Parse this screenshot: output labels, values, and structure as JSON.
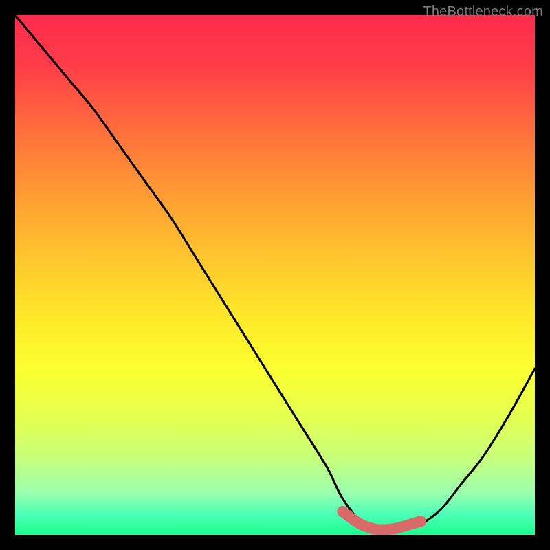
{
  "watermark": "TheBottleneck.com",
  "chart_data": {
    "type": "line",
    "title": "",
    "xlabel": "",
    "ylabel": "",
    "x_range": [
      0,
      100
    ],
    "y_range": [
      0,
      100
    ],
    "grid": false,
    "legend": false,
    "series": [
      {
        "name": "curve",
        "color": "#000000",
        "x": [
          0,
          5,
          10,
          15,
          20,
          25,
          30,
          35,
          40,
          45,
          50,
          55,
          60,
          63,
          67,
          70,
          75,
          78,
          82,
          86,
          90,
          95,
          100
        ],
        "y": [
          100,
          94,
          88,
          82,
          75,
          68,
          61,
          53,
          45,
          37,
          29,
          21,
          13,
          7,
          2,
          1,
          1,
          2,
          5,
          10,
          15,
          23,
          32
        ]
      }
    ],
    "highlight_segment": {
      "color": "#d86a6a",
      "x": [
        63,
        65,
        67,
        70,
        73,
        75,
        78
      ],
      "y": [
        4.5,
        3.0,
        1.8,
        1.0,
        1.2,
        1.7,
        2.6
      ]
    },
    "highlight_point": {
      "color": "#d86a6a",
      "x": 78,
      "y": 2.6,
      "radius": 6
    }
  }
}
